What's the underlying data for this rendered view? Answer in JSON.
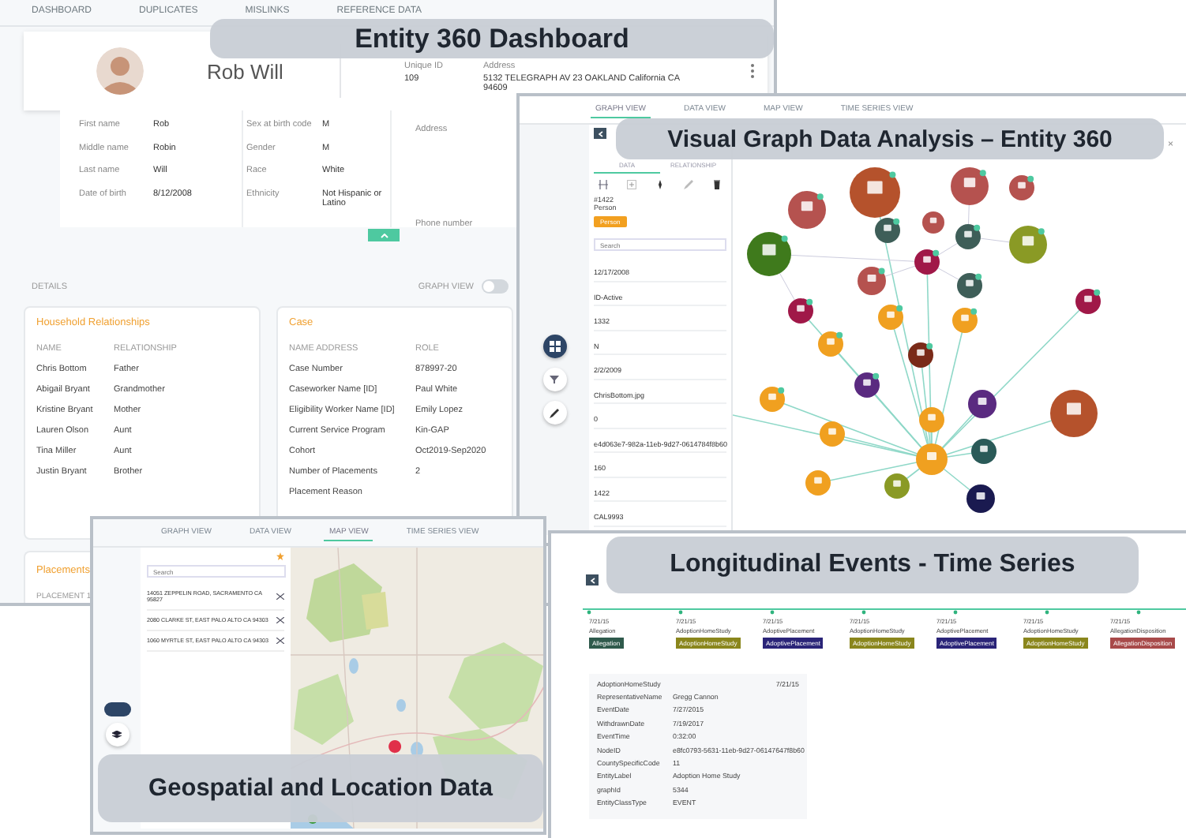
{
  "dashboard": {
    "caption": "Entity 360 Dashboard",
    "tabs": [
      {
        "label": "DASHBOARD"
      },
      {
        "label": "DUPLICATES"
      },
      {
        "label": "MISLINKS"
      },
      {
        "label": "REFERENCE DATA"
      }
    ],
    "header": {
      "name": "Rob Will",
      "fields": [
        {
          "label": "Unique ID",
          "value": "109"
        },
        {
          "label": "Address",
          "value": "5132 TELEGRAPH AV 23 OAKLAND California CA 94609"
        }
      ]
    },
    "details": [
      [
        {
          "label": "First name",
          "value": "Rob"
        },
        {
          "label": "Middle name",
          "value": "Robin"
        },
        {
          "label": "Last name",
          "value": "Will"
        },
        {
          "label": "Date of birth",
          "value": "8/12/2008"
        }
      ],
      [
        {
          "label": "Sex at birth code",
          "value": "M"
        },
        {
          "label": "Gender",
          "value": "M"
        },
        {
          "label": "Race",
          "value": "White"
        },
        {
          "label": "Ethnicity",
          "value": "Not Hispanic or Latino"
        }
      ],
      [
        {
          "label": "Address"
        },
        {
          "label": "Phone number"
        }
      ]
    ],
    "section_label": "DETAILS",
    "graph_toggle": {
      "label": "GRAPH VIEW",
      "on": false
    },
    "household": {
      "title": "Household Relationships",
      "columns": [
        "NAME",
        "RELATIONSHIP"
      ],
      "rows": [
        [
          "Chris Bottom",
          "Father"
        ],
        [
          "Abigail Bryant",
          "Grandmother"
        ],
        [
          "Kristine Bryant",
          "Mother"
        ],
        [
          "Lauren Olson",
          "Aunt"
        ],
        [
          "Tina Miller",
          "Aunt"
        ],
        [
          "Justin Bryant",
          "Brother"
        ]
      ]
    },
    "case": {
      "title": "Case",
      "columns": [
        "NAME ADDRESS",
        "ROLE"
      ],
      "rows": [
        [
          "Case Number",
          "878997-20"
        ],
        [
          "Caseworker Name [ID]",
          "Paul White"
        ],
        [
          "Eligibility Worker Name [ID]",
          "Emily Lopez"
        ],
        [
          "Current Service Program",
          "Kin-GAP"
        ],
        [
          "Cohort",
          "Oct2019-Sep2020"
        ],
        [
          "Number of Placements",
          "2"
        ],
        [
          "Placement Reason",
          ""
        ]
      ]
    },
    "placements": {
      "title": "Placements",
      "subtitle": "PLACEMENT 1"
    }
  },
  "graph_view": {
    "caption": "Visual Graph Data Analysis – Entity 360",
    "tabs": [
      {
        "label": "GRAPH VIEW",
        "selected": true
      },
      {
        "label": "DATA VIEW",
        "selected": false
      },
      {
        "label": "MAP VIEW",
        "selected": false
      },
      {
        "label": "TIME SERIES VIEW",
        "selected": false
      }
    ],
    "panel_tabs": [
      {
        "label": "DATA",
        "selected": true
      },
      {
        "label": "RELATIONSHIP",
        "selected": false
      }
    ],
    "record_id": "#1422",
    "record_type": "Person",
    "chip": "Person",
    "search": {
      "placeholder": "Search"
    },
    "values": [
      "12/17/2008",
      "ID-Active",
      "1332",
      "N",
      "2/2/2009",
      "ChrisBottom.jpg",
      "0",
      "e4d063e7-982a-11eb-9d27-0614784f8b60",
      "160",
      "1422",
      "CAL9993"
    ],
    "close": "×"
  },
  "map_view": {
    "caption": "Geospatial and Location Data",
    "tabs": [
      {
        "label": "GRAPH VIEW",
        "selected": false
      },
      {
        "label": "DATA VIEW",
        "selected": false
      },
      {
        "label": "MAP VIEW",
        "selected": true
      },
      {
        "label": "TIME SERIES VIEW",
        "selected": false
      }
    ],
    "search": {
      "placeholder": "Search"
    },
    "addresses": [
      "14051 ZEPPELIN ROAD, SACRAMENTO CA 95827",
      "2080 CLARKE ST, EAST PALO ALTO CA 94303",
      "1060 MYRTLE ST, EAST PALO ALTO CA 94303"
    ]
  },
  "time_series": {
    "caption": "Longitudinal Events - Time Series",
    "events": [
      {
        "date": "7/21/15",
        "name": "Allegation",
        "chip": "Allegation",
        "color": "#2f5a4c"
      },
      {
        "date": "7/21/15",
        "name": "AdoptionHomeStudy",
        "chip": "AdoptionHomeStudy",
        "color": "#8a861c"
      },
      {
        "date": "7/21/15",
        "name": "AdoptivePlacement",
        "chip": "AdoptivePlacement",
        "color": "#2a2478"
      },
      {
        "date": "7/21/15",
        "name": "AdoptionHomeStudy",
        "chip": "AdoptionHomeStudy",
        "color": "#8a861c"
      },
      {
        "date": "7/21/15",
        "name": "AdoptivePlacement",
        "chip": "AdoptivePlacement",
        "color": "#2a2478"
      },
      {
        "date": "7/21/15",
        "name": "AdoptionHomeStudy",
        "chip": "AdoptionHomeStudy",
        "color": "#8a861c"
      },
      {
        "date": "7/21/15",
        "name": "AllegationDisposition",
        "chip": "AllegationDisposition",
        "color": "#a84a4a"
      }
    ],
    "detail": {
      "title": "AdoptionHomeStudy",
      "date": "7/21/15",
      "rows": [
        {
          "label": "RepresentativeName",
          "value": "Gregg Cannon"
        },
        {
          "label": "EventDate",
          "value": "7/27/2015"
        },
        {
          "label": "WithdrawnDate",
          "value": "7/19/2017"
        },
        {
          "label": "EventTime",
          "value": "0:32:00"
        },
        {
          "label": "NodeID",
          "value": "e8fc0793-5631-11eb-9d27-06147647f8b60"
        },
        {
          "label": "CountySpecificCode",
          "value": "11"
        },
        {
          "label": "EntityLabel",
          "value": "Adoption Home Study"
        },
        {
          "label": "graphId",
          "value": "5344"
        },
        {
          "label": "EntityClassType",
          "value": "EVENT"
        }
      ]
    }
  }
}
